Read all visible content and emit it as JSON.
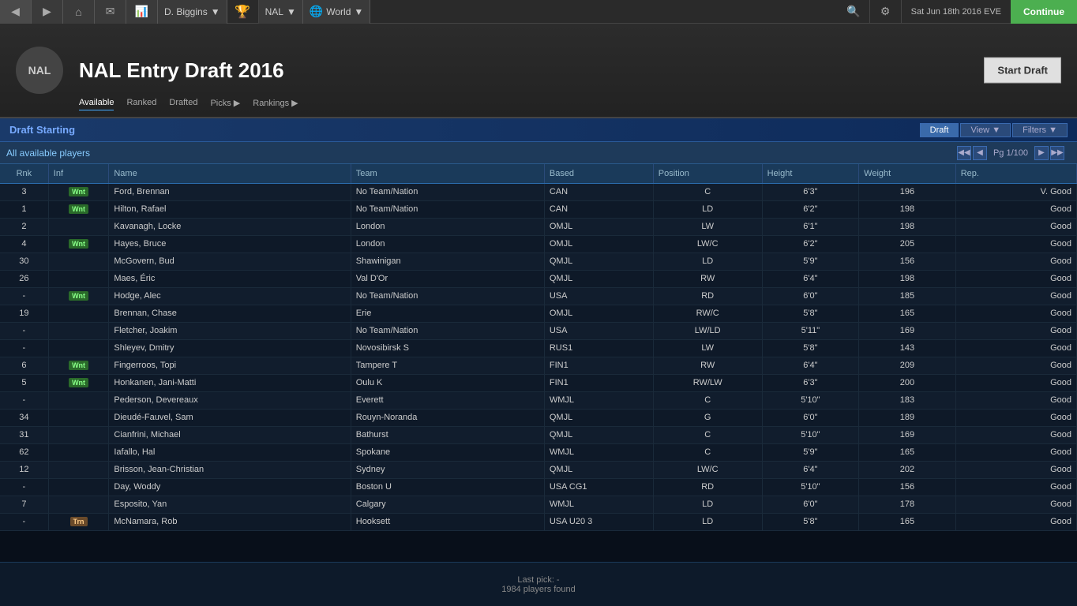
{
  "topbar": {
    "prev_label": "◀",
    "next_label": "▶",
    "home_label": "⌂",
    "mail_label": "✉",
    "map_label": "🗺",
    "manager_name": "D. Biggins",
    "manager_arrow": "▼",
    "trophy_label": "🏆",
    "league_name": "NAL",
    "league_arrow": "▼",
    "globe_label": "🌐",
    "world_label": "World",
    "world_arrow": "▼",
    "search_label": "🔍",
    "settings_label": "⚙",
    "calendar_label": "📅",
    "date": "Sat Jun 18th 2016 EVE",
    "continue_label": "Continue"
  },
  "header": {
    "league_abbr": "NAL",
    "title": "NAL Entry Draft 2016",
    "tabs": [
      "Available",
      "Ranked",
      "Drafted",
      "Picks ▶",
      "Rankings ▶"
    ],
    "start_draft_label": "Start Draft"
  },
  "banner": {
    "title": "Draft Starting",
    "draft_label": "Draft",
    "view_label": "View",
    "view_arrow": "▼",
    "filters_label": "Filters",
    "filters_arrow": "▼"
  },
  "listing": {
    "title": "All available players",
    "page_first": "◀◀",
    "page_prev": "◀",
    "page_info": "Pg 1/100",
    "page_next": "▶",
    "page_last": "▶▶"
  },
  "table": {
    "headers": [
      "Rnk",
      "Inf",
      "Name",
      "Team",
      "Based",
      "Position",
      "Height",
      "Weight",
      "Rep."
    ],
    "rows": [
      {
        "rnk": "3",
        "inf": "Wnt",
        "name": "Ford, Brennan",
        "team": "No Team/Nation",
        "based": "CAN",
        "based_class": "based-can",
        "position": "C",
        "pos_class": "pos-c",
        "height": "6'3\"",
        "weight": "196",
        "rep": "V. Good"
      },
      {
        "rnk": "1",
        "inf": "Wnt",
        "name": "Hilton, Rafael",
        "team": "No Team/Nation",
        "based": "CAN",
        "based_class": "based-can",
        "position": "LD",
        "pos_class": "pos-ld-rd",
        "height": "6'2\"",
        "weight": "198",
        "rep": "Good"
      },
      {
        "rnk": "2",
        "inf": "",
        "name": "Kavanagh, Locke",
        "team": "London",
        "based": "OMJL",
        "based_class": "based-omjl",
        "position": "LW",
        "pos_class": "pos-rw-lw",
        "height": "6'1\"",
        "weight": "198",
        "rep": "Good"
      },
      {
        "rnk": "4",
        "inf": "Wnt",
        "name": "Hayes, Bruce",
        "team": "London",
        "based": "OMJL",
        "based_class": "based-omjl",
        "position": "LW/C",
        "pos_class": "pos-rw-lw",
        "height": "6'2\"",
        "weight": "205",
        "rep": "Good"
      },
      {
        "rnk": "30",
        "inf": "",
        "name": "McGovern, Bud",
        "team": "Shawinigan",
        "based": "QMJL",
        "based_class": "based-qmjl",
        "position": "LD",
        "pos_class": "pos-ld-rd",
        "height": "5'9\"",
        "weight": "156",
        "rep": "Good"
      },
      {
        "rnk": "26",
        "inf": "",
        "name": "Maes, Éric",
        "team": "Val D'Or",
        "based": "QMJL",
        "based_class": "based-qmjl",
        "position": "RW",
        "pos_class": "pos-rw-lw",
        "height": "6'4\"",
        "weight": "198",
        "rep": "Good"
      },
      {
        "rnk": "-",
        "inf": "Wnt",
        "name": "Hodge, Alec",
        "team": "No Team/Nation",
        "based": "USA",
        "based_class": "based-usa",
        "position": "RD",
        "pos_class": "pos-ld-rd",
        "height": "6'0\"",
        "weight": "185",
        "rep": "Good"
      },
      {
        "rnk": "19",
        "inf": "",
        "name": "Brennan, Chase",
        "team": "Erie",
        "based": "OMJL",
        "based_class": "based-omjl",
        "position": "RW/C",
        "pos_class": "pos-rw-lw",
        "height": "5'8\"",
        "weight": "165",
        "rep": "Good"
      },
      {
        "rnk": "-",
        "inf": "",
        "name": "Fletcher, Joakim",
        "team": "No Team/Nation",
        "based": "USA",
        "based_class": "based-usa",
        "position": "LW/LD",
        "pos_class": "pos-rw-lw",
        "height": "5'11\"",
        "weight": "169",
        "rep": "Good"
      },
      {
        "rnk": "-",
        "inf": "",
        "name": "Shleyev, Dmitry",
        "team": "Novosibirsk S",
        "based": "RUS1",
        "based_class": "based-rus",
        "position": "LW",
        "pos_class": "pos-rw-lw",
        "height": "5'8\"",
        "weight": "143",
        "rep": "Good"
      },
      {
        "rnk": "6",
        "inf": "Wnt",
        "name": "Fingerroos, Topi",
        "team": "Tampere T",
        "based": "FIN1",
        "based_class": "based-fin",
        "position": "RW",
        "pos_class": "pos-rw-lw",
        "height": "6'4\"",
        "weight": "209",
        "rep": "Good"
      },
      {
        "rnk": "5",
        "inf": "Wnt",
        "name": "Honkanen, Jani-Matti",
        "team": "Oulu K",
        "based": "FIN1",
        "based_class": "based-fin",
        "position": "RW/LW",
        "pos_class": "pos-rw-lw",
        "height": "6'3\"",
        "weight": "200",
        "rep": "Good"
      },
      {
        "rnk": "-",
        "inf": "",
        "name": "Pederson, Devereaux",
        "team": "Everett",
        "based": "WMJL",
        "based_class": "based-wmjl",
        "position": "C",
        "pos_class": "pos-c",
        "height": "5'10\"",
        "weight": "183",
        "rep": "Good"
      },
      {
        "rnk": "34",
        "inf": "",
        "name": "Dieudé-Fauvel, Sam",
        "team": "Rouyn-Noranda",
        "based": "QMJL",
        "based_class": "based-qmjl",
        "position": "G",
        "pos_class": "pos-g",
        "height": "6'0\"",
        "weight": "189",
        "rep": "Good"
      },
      {
        "rnk": "31",
        "inf": "",
        "name": "Cianfrini, Michael",
        "team": "Bathurst",
        "based": "QMJL",
        "based_class": "based-qmjl",
        "position": "C",
        "pos_class": "pos-c",
        "height": "5'10\"",
        "weight": "169",
        "rep": "Good"
      },
      {
        "rnk": "62",
        "inf": "",
        "name": "Iafallo, Hal",
        "team": "Spokane",
        "based": "WMJL",
        "based_class": "based-wmjl",
        "position": "C",
        "pos_class": "pos-c",
        "height": "5'9\"",
        "weight": "165",
        "rep": "Good"
      },
      {
        "rnk": "12",
        "inf": "",
        "name": "Brisson, Jean-Christian",
        "team": "Sydney",
        "based": "QMJL",
        "based_class": "based-qmjl",
        "position": "LW/C",
        "pos_class": "pos-rw-lw",
        "height": "6'4\"",
        "weight": "202",
        "rep": "Good"
      },
      {
        "rnk": "-",
        "inf": "",
        "name": "Day, Woddy",
        "team": "Boston U",
        "based": "USA CG1",
        "based_class": "based-usacg",
        "position": "RD",
        "pos_class": "pos-ld-rd",
        "height": "5'10\"",
        "weight": "156",
        "rep": "Good"
      },
      {
        "rnk": "7",
        "inf": "",
        "name": "Esposito, Yan",
        "team": "Calgary",
        "based": "WMJL",
        "based_class": "based-wmjl",
        "position": "LD",
        "pos_class": "pos-ld-rd",
        "height": "6'0\"",
        "weight": "178",
        "rep": "Good"
      },
      {
        "rnk": "-",
        "inf": "Trn",
        "name": "McNamara, Rob",
        "team": "Hooksett",
        "based": "USA U20 3",
        "based_class": "based-usa",
        "position": "LD",
        "pos_class": "pos-ld-rd",
        "height": "5'8\"",
        "weight": "165",
        "rep": "Good"
      }
    ]
  },
  "footer": {
    "last_pick": "Last pick: -",
    "players_found": "1984 players found"
  }
}
